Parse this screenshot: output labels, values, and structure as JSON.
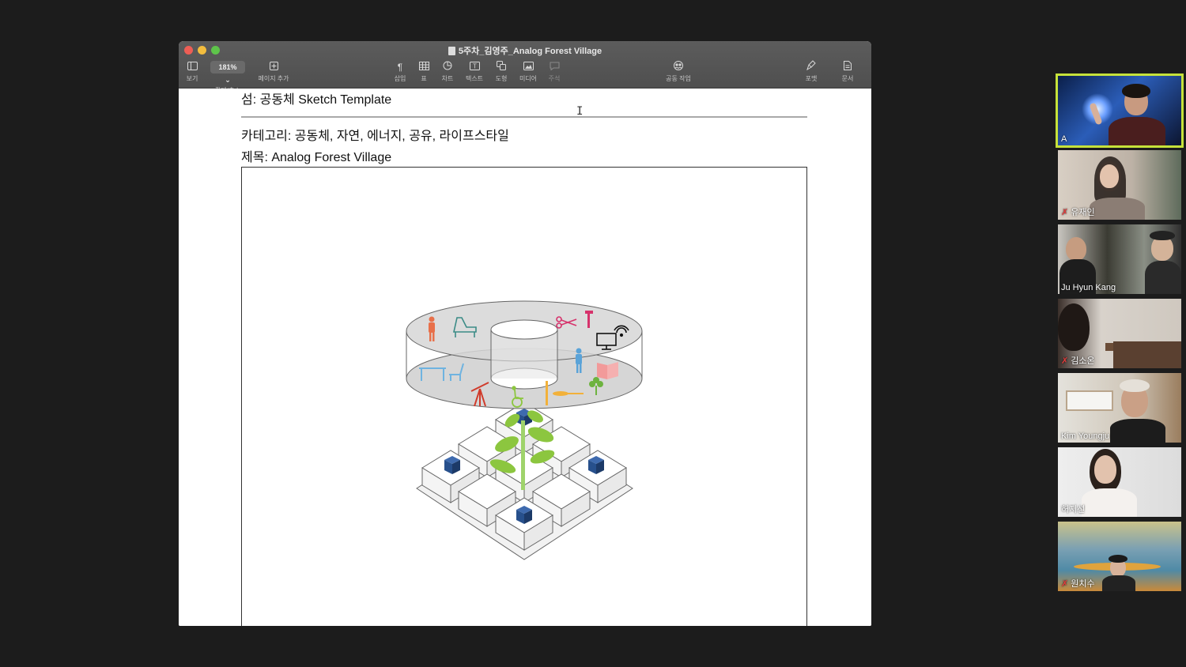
{
  "window": {
    "title": "5주차_김영주_Analog Forest Village"
  },
  "toolbar": {
    "view": "보기",
    "zoom_value": "181%",
    "zoom": "확대/축소",
    "add_page": "페이지 추가",
    "insert": "삽입",
    "table": "표",
    "chart": "차트",
    "text": "텍스트",
    "shape": "도형",
    "media": "미디어",
    "comment": "주석",
    "collaborate": "공동 작업",
    "format": "포맷",
    "document": "문서"
  },
  "document": {
    "island_line": "섬: 공동체 Sketch Template",
    "category_line": "카테고리: 공동체, 자연, 에너지, 공유, 라이프스타일",
    "title_line": "제목: Analog Forest Village"
  },
  "colors": {
    "active_speaker_border": "#c6e23a",
    "cube_blue": "#27508c",
    "plant_green": "#8cc63f",
    "ring_gray": "#d6d6d6"
  },
  "participants": [
    {
      "name": "A",
      "muted": false,
      "active": true
    },
    {
      "name": "유재인",
      "muted": true,
      "active": false
    },
    {
      "name": "Ju Hyun Kang",
      "muted": false,
      "active": false
    },
    {
      "name": "김소온",
      "muted": true,
      "active": false
    },
    {
      "name": "Kim Youngju",
      "muted": false,
      "active": false
    },
    {
      "name": "허지선",
      "muted": false,
      "active": false
    },
    {
      "name": "원치수",
      "muted": true,
      "active": false
    }
  ]
}
